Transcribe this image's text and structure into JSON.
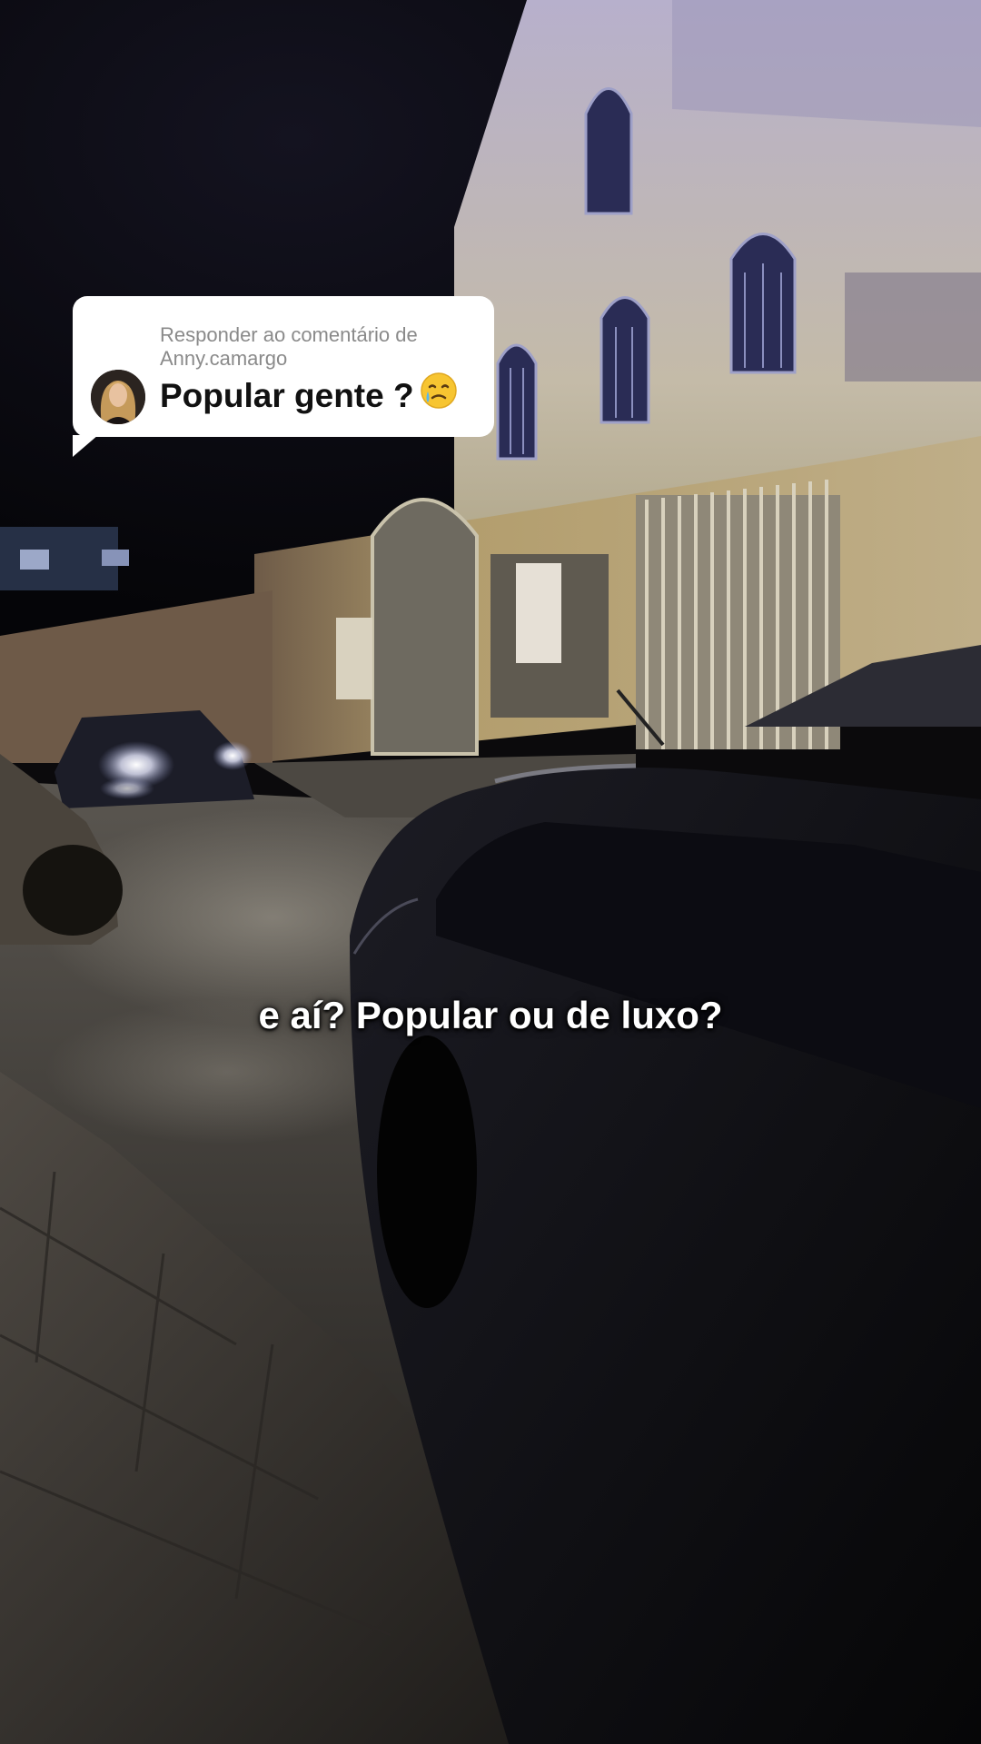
{
  "reply": {
    "header": "Responder ao comentário de Anny.camargo",
    "text": "Popular gente ?",
    "emoji_icon": "face-holding-back-tears-icon",
    "avatar_icon": "user-avatar"
  },
  "caption": "e aí? Popular ou de luxo?",
  "colors": {
    "bubble": "#ffffff",
    "reply_text": "#111111",
    "header_text": "#8a8a8a",
    "caption_text": "#ffffff"
  }
}
